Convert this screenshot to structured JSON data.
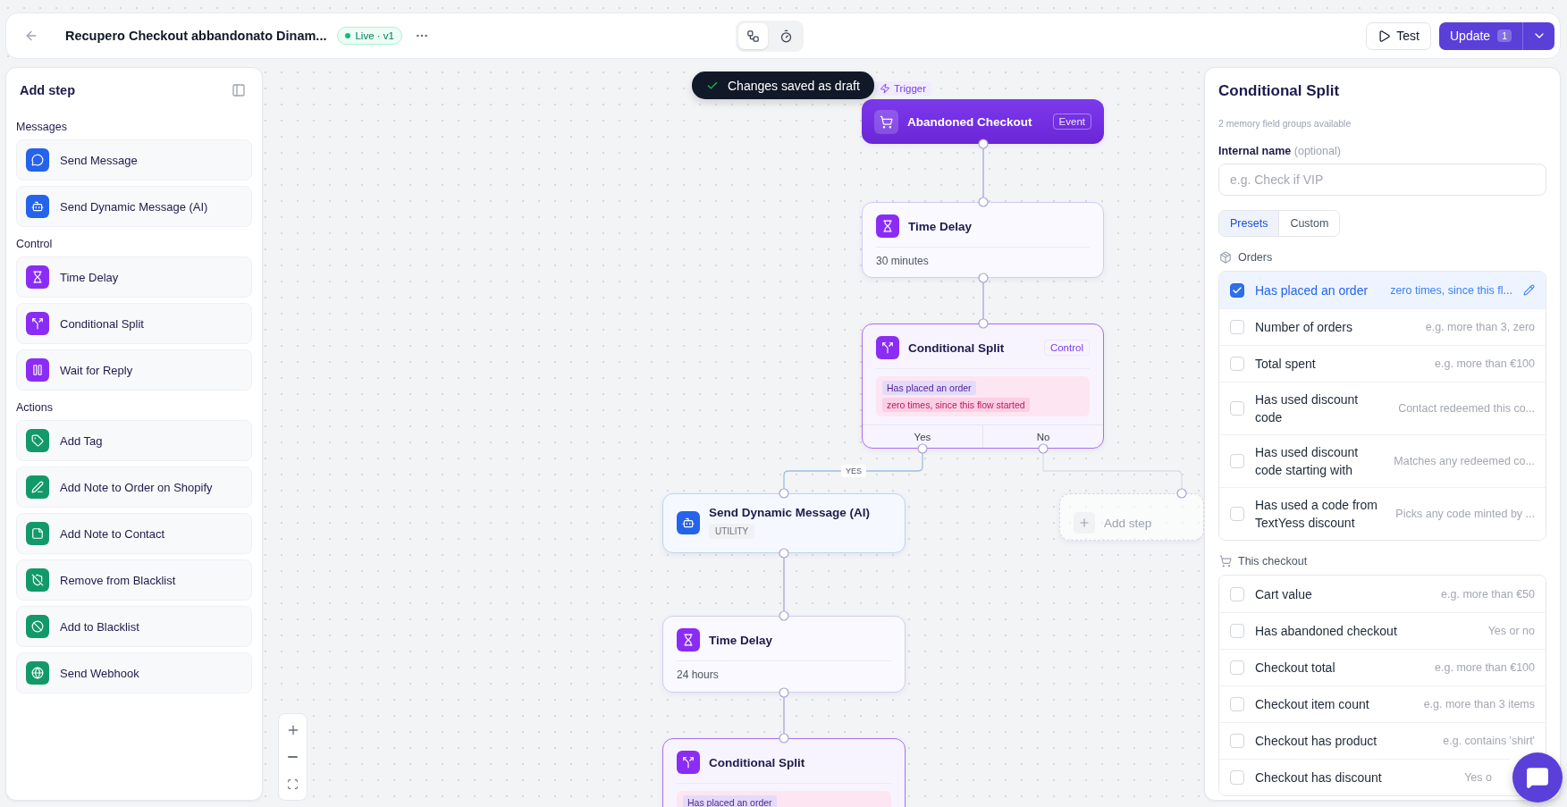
{
  "header": {
    "title": "Recupero Checkout abbandonato Dinam...",
    "status": "Live · v1",
    "view_modes": [
      {
        "kind": "flow",
        "selected": true
      },
      {
        "kind": "timer",
        "selected": false
      }
    ],
    "test_button": "Test",
    "update_button": {
      "label": "Update",
      "count": "1"
    }
  },
  "left_panel": {
    "title": "Add step",
    "groups": [
      {
        "title": "Messages",
        "color": "#2563eb",
        "items": [
          {
            "label": "Send Message",
            "kind": "chat"
          },
          {
            "label": "Send Dynamic Message (AI)",
            "kind": "bot"
          }
        ]
      },
      {
        "title": "Control",
        "color": "#8b2cf5",
        "items": [
          {
            "label": "Time Delay",
            "kind": "delay"
          },
          {
            "label": "Conditional Split",
            "kind": "split"
          },
          {
            "label": "Wait for Reply",
            "kind": "wait"
          }
        ]
      },
      {
        "title": "Actions",
        "color": "#12996a",
        "items": [
          {
            "label": "Add Tag",
            "kind": "tag"
          },
          {
            "label": "Add Note to Order on Shopify",
            "kind": "pen"
          },
          {
            "label": "Add Note to Contact",
            "kind": "note"
          },
          {
            "label": "Remove from Blacklist",
            "kind": "unblock"
          },
          {
            "label": "Add to Blacklist",
            "kind": "block"
          },
          {
            "label": "Send Webhook",
            "kind": "webhook"
          }
        ]
      }
    ]
  },
  "canvas": {
    "toast": "Changes saved as draft",
    "branch_label": "YES",
    "nodes": [
      {
        "kind": "trigger",
        "tag": "Trigger",
        "title": "Abandoned Checkout",
        "badge": "Event"
      },
      {
        "kind": "delay",
        "title": "Time Delay",
        "detail": "30 minutes"
      },
      {
        "kind": "split",
        "title": "Conditional Split",
        "badge": "Control",
        "condition": "Has placed an order",
        "qualifier": "zero times, since this flow started",
        "branches": [
          "Yes",
          "No"
        ]
      },
      {
        "kind": "message",
        "title": "Send Dynamic Message (AI)",
        "badge": "UTILITY"
      },
      {
        "kind": "placeholder",
        "title": "Add step"
      },
      {
        "kind": "delay",
        "title": "Time Delay",
        "detail": "24 hours"
      },
      {
        "kind": "split",
        "title": "Conditional Split",
        "condition": "Has placed an order"
      }
    ]
  },
  "right_panel": {
    "title": "Conditional Split",
    "subtitle": "2 memory field groups available",
    "field": {
      "label": "Internal name",
      "note": "(optional)",
      "placeholder": "e.g. Check if VIP"
    },
    "tabs": [
      {
        "label": "Presets",
        "selected": true
      },
      {
        "label": "Custom",
        "selected": false
      }
    ],
    "groups": [
      {
        "title": "Orders",
        "kind": "box",
        "options": [
          {
            "label": "Has placed an order",
            "hint": "zero times, since this fl...",
            "checked": true
          },
          {
            "label": "Number of orders",
            "hint": "e.g. more than 3, zero",
            "checked": false
          },
          {
            "label": "Total spent",
            "hint": "e.g. more than €100",
            "checked": false
          },
          {
            "label": "Has used discount code",
            "hint": "Contact redeemed this co...",
            "checked": false
          },
          {
            "label": "Has used discount code starting with",
            "hint": "Matches any redeemed co...",
            "checked": false
          },
          {
            "label": "Has used a code from TextYess discount",
            "hint": "Picks any code minted by ...",
            "checked": false
          }
        ]
      },
      {
        "title": "This checkout",
        "kind": "cart",
        "options": [
          {
            "label": "Cart value",
            "hint": "e.g. more than €50",
            "checked": false
          },
          {
            "label": "Has abandoned checkout",
            "hint": "Yes or no",
            "checked": false
          },
          {
            "label": "Checkout total",
            "hint": "e.g. more than €100",
            "checked": false
          },
          {
            "label": "Checkout item count",
            "hint": "e.g. more than 3 items",
            "checked": false
          },
          {
            "label": "Checkout has product",
            "hint": "e.g. contains 'shirt'",
            "checked": false
          },
          {
            "label": "Checkout has discount",
            "hint": "Yes o",
            "checked": false
          }
        ]
      }
    ]
  }
}
